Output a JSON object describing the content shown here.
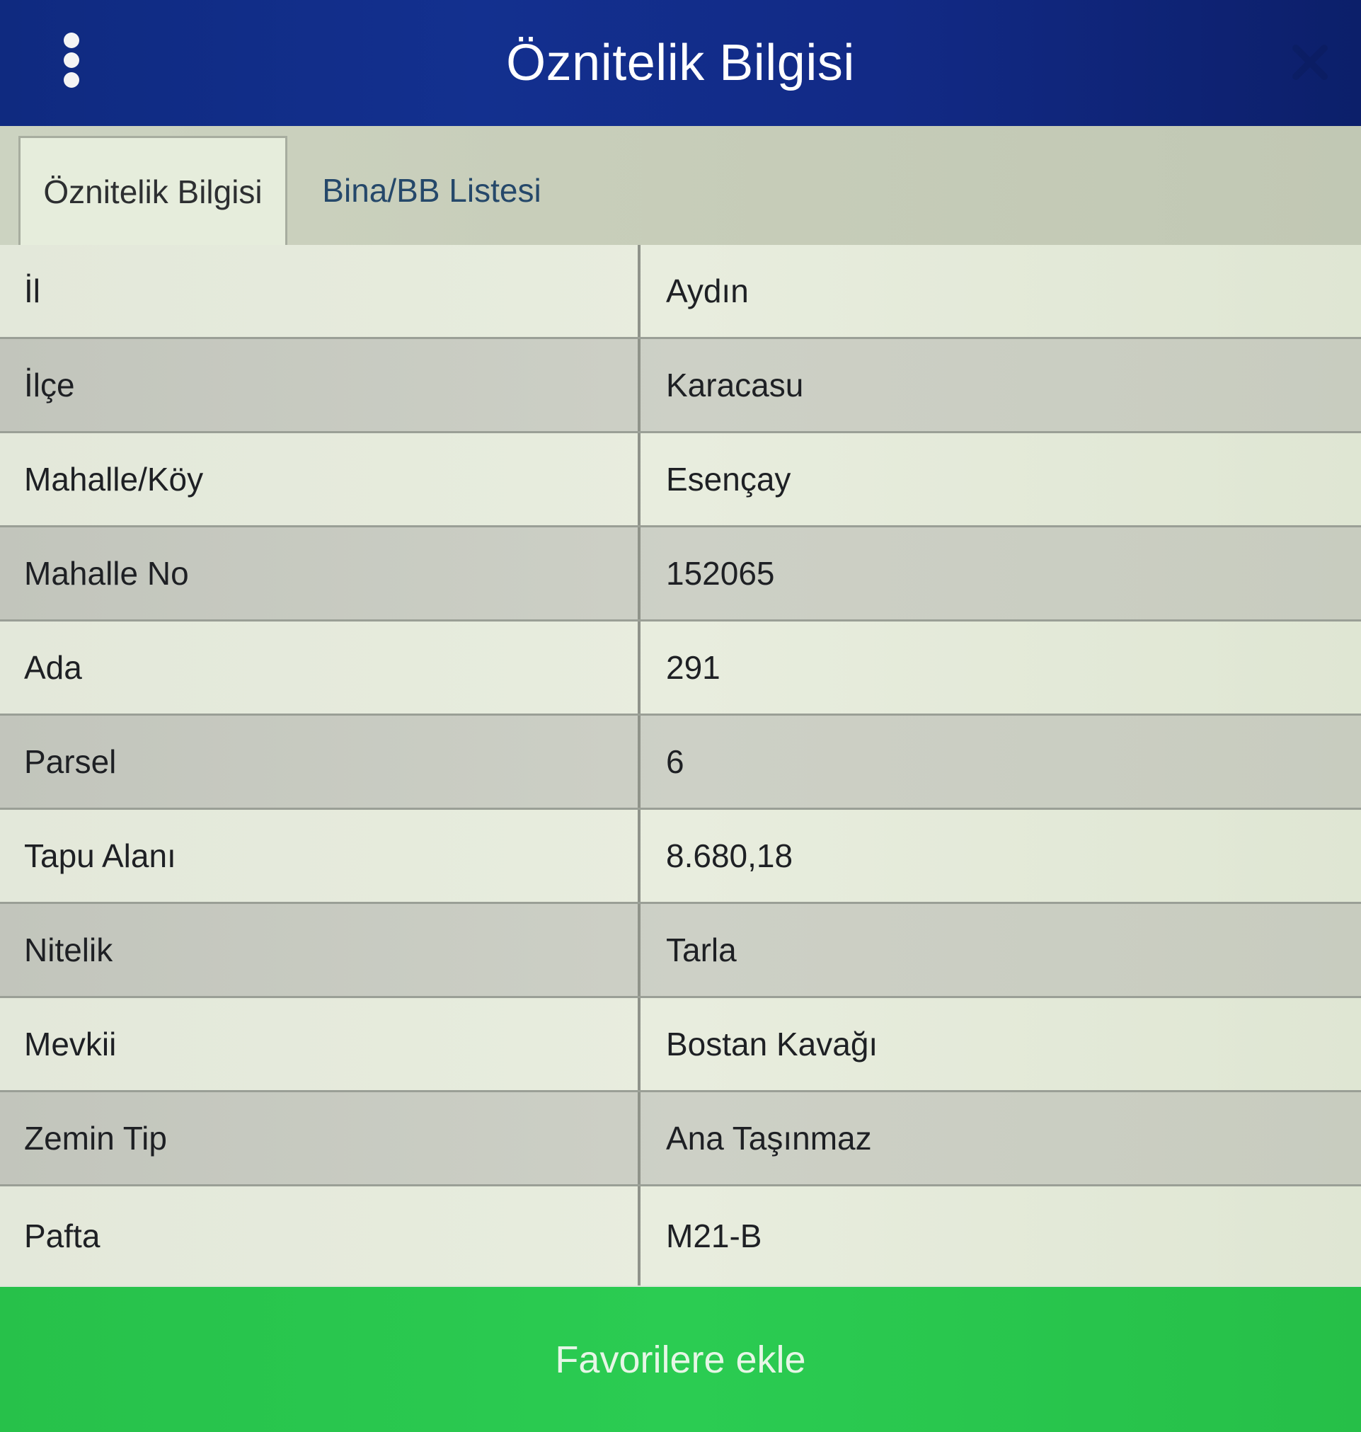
{
  "header": {
    "title": "Öznitelik Bilgisi",
    "menu_icon": "kebab-menu-icon",
    "close_icon": "close-icon"
  },
  "tabs": [
    {
      "label": "Öznitelik Bilgisi",
      "active": true
    },
    {
      "label": "Bina/BB Listesi",
      "active": false
    }
  ],
  "rows": [
    {
      "label": "İl",
      "value": "Aydın"
    },
    {
      "label": "İlçe",
      "value": "Karacasu"
    },
    {
      "label": "Mahalle/Köy",
      "value": "Esençay"
    },
    {
      "label": "Mahalle No",
      "value": "152065"
    },
    {
      "label": "Ada",
      "value": "291"
    },
    {
      "label": "Parsel",
      "value": "6"
    },
    {
      "label": "Tapu Alanı",
      "value": "8.680,18"
    },
    {
      "label": "Nitelik",
      "value": "Tarla"
    },
    {
      "label": "Mevkii",
      "value": "Bostan Kavağı"
    },
    {
      "label": "Zemin Tip",
      "value": "Ana Taşınmaz"
    },
    {
      "label": "Pafta",
      "value": "M21-B"
    }
  ],
  "footer": {
    "button_label": "Favorilere ekle"
  },
  "colors": {
    "header_bg": "#13308f",
    "footer_bg": "#2bcc52",
    "tab_inactive_text": "#25486a"
  }
}
